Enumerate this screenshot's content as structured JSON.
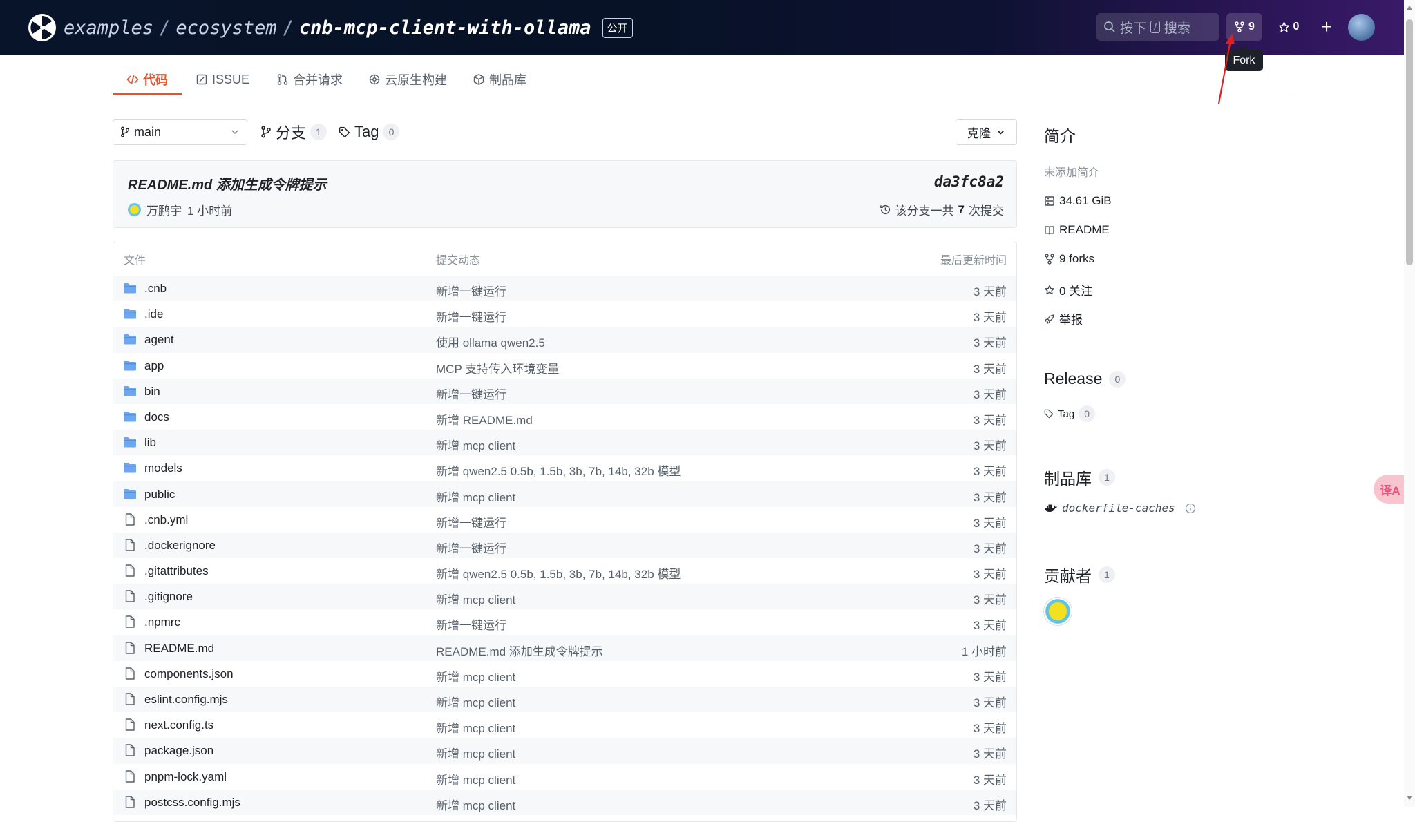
{
  "header": {
    "path": [
      "examples",
      "ecosystem"
    ],
    "repo": "cnb-mcp-client-with-ollama",
    "visibility": "公开",
    "search": {
      "press": "按下",
      "key": "/",
      "label": "搜索"
    },
    "fork_count": "9",
    "star_count": "0",
    "plus": "+",
    "tooltip": "Fork"
  },
  "tabs": [
    {
      "label": "代码",
      "icon": "code-icon"
    },
    {
      "label": "ISSUE",
      "icon": "issue-icon"
    },
    {
      "label": "合并请求",
      "icon": "pull-request-icon"
    },
    {
      "label": "云原生构建",
      "icon": "build-icon"
    },
    {
      "label": "制品库",
      "icon": "package-icon"
    }
  ],
  "branch_bar": {
    "branch": "main",
    "branches_label": "分支",
    "branches_count": "1",
    "tags_label": "Tag",
    "tags_count": "0",
    "clone_label": "克隆"
  },
  "commit": {
    "message": "README.md 添加生成令牌提示",
    "hash": "da3fc8a2",
    "author": "万鹏宇",
    "time": "1 小时前",
    "count_prefix": "该分支一共",
    "count": "7",
    "count_suffix": "次提交"
  },
  "file_table": {
    "headers": {
      "file": "文件",
      "commit": "提交动态",
      "updated": "最后更新时间"
    },
    "rows": [
      {
        "name": ".cnb",
        "type": "folder",
        "msg": "新增一键运行",
        "time": "3 天前"
      },
      {
        "name": ".ide",
        "type": "folder",
        "msg": "新增一键运行",
        "time": "3 天前"
      },
      {
        "name": "agent",
        "type": "folder",
        "msg": "使用 ollama qwen2.5",
        "time": "3 天前"
      },
      {
        "name": "app",
        "type": "folder",
        "msg": "MCP 支持传入环境变量",
        "time": "3 天前"
      },
      {
        "name": "bin",
        "type": "folder",
        "msg": "新增一键运行",
        "time": "3 天前"
      },
      {
        "name": "docs",
        "type": "folder",
        "msg": "新增 README.md",
        "time": "3 天前"
      },
      {
        "name": "lib",
        "type": "folder",
        "msg": "新增 mcp client",
        "time": "3 天前"
      },
      {
        "name": "models",
        "type": "folder",
        "msg": "新增 qwen2.5 0.5b, 1.5b, 3b, 7b, 14b, 32b 模型",
        "time": "3 天前"
      },
      {
        "name": "public",
        "type": "folder",
        "msg": "新增 mcp client",
        "time": "3 天前"
      },
      {
        "name": ".cnb.yml",
        "type": "file",
        "msg": "新增一键运行",
        "time": "3 天前"
      },
      {
        "name": ".dockerignore",
        "type": "file",
        "msg": "新增一键运行",
        "time": "3 天前"
      },
      {
        "name": ".gitattributes",
        "type": "file",
        "msg": "新增 qwen2.5 0.5b, 1.5b, 3b, 7b, 14b, 32b 模型",
        "time": "3 天前"
      },
      {
        "name": ".gitignore",
        "type": "file",
        "msg": "新增 mcp client",
        "time": "3 天前"
      },
      {
        "name": ".npmrc",
        "type": "file",
        "msg": "新增一键运行",
        "time": "3 天前"
      },
      {
        "name": "README.md",
        "type": "file",
        "msg": "README.md 添加生成令牌提示",
        "time": "1 小时前"
      },
      {
        "name": "components.json",
        "type": "file",
        "msg": "新增 mcp client",
        "time": "3 天前"
      },
      {
        "name": "eslint.config.mjs",
        "type": "file",
        "msg": "新增 mcp client",
        "time": "3 天前"
      },
      {
        "name": "next.config.ts",
        "type": "file",
        "msg": "新增 mcp client",
        "time": "3 天前"
      },
      {
        "name": "package.json",
        "type": "file",
        "msg": "新增 mcp client",
        "time": "3 天前"
      },
      {
        "name": "pnpm-lock.yaml",
        "type": "file",
        "msg": "新增 mcp client",
        "time": "3 天前"
      },
      {
        "name": "postcss.config.mjs",
        "type": "file",
        "msg": "新增 mcp client",
        "time": "3 天前"
      }
    ]
  },
  "sidebar": {
    "about_title": "简介",
    "about_empty": "未添加简介",
    "size": "34.61 GiB",
    "readme": "README",
    "forks": "9 forks",
    "stars": "0 关注",
    "report": "举报",
    "release_title": "Release",
    "release_count": "0",
    "tag_label": "Tag",
    "tag_count": "0",
    "packages_title": "制品库",
    "packages_count": "1",
    "package_name": "dockerfile-caches",
    "contributors_title": "贡献者",
    "contributors_count": "1"
  },
  "translate_button": "译A",
  "colors": {
    "accent": "#e8532b",
    "folder": "#6ea6f0",
    "header_dark": "#071226",
    "annotation": "#e02020"
  }
}
